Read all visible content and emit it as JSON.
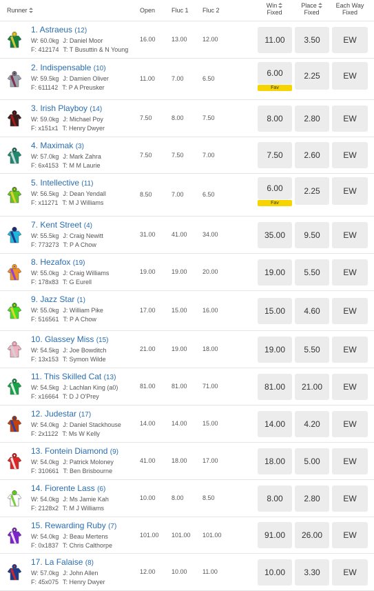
{
  "header": {
    "runner": "Runner",
    "open": "Open",
    "fluc1": "Fluc 1",
    "fluc2": "Fluc 2",
    "win": [
      "Win",
      "Fixed"
    ],
    "place": [
      "Place",
      "Fixed"
    ],
    "ew": [
      "Each Way",
      "Fixed"
    ]
  },
  "colors": {
    "link": "#2a6db0",
    "button": "#ececec",
    "fav": "#f6d400"
  },
  "runners": [
    {
      "name": "1. Astraeus",
      "barrier": "(12)",
      "weight": "W: 60.0kg",
      "jockey": "J: Daniel Moor",
      "form": "F: 412174",
      "trainer": "T: T Busuttin & N Young",
      "open": "16.00",
      "fluc1": "13.00",
      "fluc2": "12.00",
      "win": "11.00",
      "place": "3.50",
      "ew": "EW",
      "fav": "",
      "silk": [
        "#15803d",
        "#f5d33a",
        "#c8ad1b"
      ]
    },
    {
      "name": "2. Indispensable",
      "barrier": "(10)",
      "weight": "W: 59.5kg",
      "jockey": "J: Damien Oliver",
      "form": "F: 611142",
      "trainer": "T: P A Preusker",
      "open": "11.00",
      "fluc1": "7.00",
      "fluc2": "6.50",
      "win": "6.00",
      "place": "2.25",
      "ew": "EW",
      "fav": "Fav",
      "silk": [
        "#9ca3af",
        "#7a1f3d",
        "#6b7280"
      ]
    },
    {
      "name": "3. Irish Playboy",
      "barrier": "(14)",
      "weight": "W: 59.0kg",
      "jockey": "J: Michael Poy",
      "form": "F: x151x1",
      "trainer": "T: Henry Dwyer",
      "open": "7.50",
      "fluc1": "8.00",
      "fluc2": "7.50",
      "win": "8.00",
      "place": "2.80",
      "ew": "EW",
      "fav": "",
      "silk": [
        "#3b1d1d",
        "#b91c1c",
        "#2b1515"
      ]
    },
    {
      "name": "4. Maximak",
      "barrier": "(3)",
      "weight": "W: 57.0kg",
      "jockey": "J: Mark Zahra",
      "form": "F: 6x4153",
      "trainer": "T: M M Laurie",
      "open": "7.50",
      "fluc1": "7.50",
      "fluc2": "7.00",
      "win": "7.50",
      "place": "2.60",
      "ew": "EW",
      "fav": "",
      "silk": [
        "#1f8a70",
        "#e5e7eb",
        "#166651"
      ]
    },
    {
      "name": "5. Intellective",
      "barrier": "(11)",
      "weight": "W: 56.5kg",
      "jockey": "J: Dean Yendall",
      "form": "F: x11271",
      "trainer": "T: M J Williams",
      "open": "8.50",
      "fluc1": "7.00",
      "fluc2": "6.50",
      "win": "6.00",
      "place": "2.25",
      "ew": "EW",
      "fav": "Fav",
      "silk": [
        "#65c41e",
        "#f5d33a",
        "#4d9a15"
      ]
    },
    {
      "name": "7. Kent Street",
      "barrier": "(4)",
      "weight": "W: 55.5kg",
      "jockey": "J: Craig Newitt",
      "form": "F: 773273",
      "trainer": "T: P A Chow",
      "open": "31.00",
      "fluc1": "41.00",
      "fluc2": "34.00",
      "win": "35.00",
      "place": "9.50",
      "ew": "EW",
      "fav": "",
      "silk": [
        "#1fb6e0",
        "#1e2a78",
        "#1e2a78"
      ]
    },
    {
      "name": "8. Hezafox",
      "barrier": "(19)",
      "weight": "W: 55.0kg",
      "jockey": "J: Craig Williams",
      "form": "F: 178x83",
      "trainer": "T: G Eurell",
      "open": "19.00",
      "fluc1": "19.00",
      "fluc2": "20.00",
      "win": "19.00",
      "place": "5.50",
      "ew": "EW",
      "fav": "",
      "silk": [
        "#f28c28",
        "#7c3aed",
        "#f59e0b"
      ]
    },
    {
      "name": "9. Jazz Star",
      "barrier": "(1)",
      "weight": "W: 55.0kg",
      "jockey": "J: William Pike",
      "form": "F: 516561",
      "trainer": "T: P A Chow",
      "open": "17.00",
      "fluc1": "15.00",
      "fluc2": "16.00",
      "win": "15.00",
      "place": "4.60",
      "ew": "EW",
      "fav": "",
      "silk": [
        "#4ade1f",
        "#f5d33a",
        "#3aa316"
      ]
    },
    {
      "name": "10. Glassey Miss",
      "barrier": "(15)",
      "weight": "W: 54.5kg",
      "jockey": "J: Joe Bowditch",
      "form": "F: 13x153",
      "trainer": "T: Symon Wilde",
      "open": "21.00",
      "fluc1": "19.00",
      "fluc2": "18.00",
      "win": "19.00",
      "place": "5.50",
      "ew": "EW",
      "fav": "",
      "silk": [
        "#f0b3c0",
        "#d1d5db",
        "#e79aab"
      ]
    },
    {
      "name": "11. This Skilled Cat",
      "barrier": "(13)",
      "weight": "W: 54.5kg",
      "jockey": "J: Lachlan King (a0)",
      "form": "F: x16664",
      "trainer": "T: D J O'Prey",
      "open": "81.00",
      "fluc1": "81.00",
      "fluc2": "71.00",
      "win": "81.00",
      "place": "21.00",
      "ew": "EW",
      "fav": "",
      "silk": [
        "#16a34a",
        "#ffffff",
        "#15803d"
      ]
    },
    {
      "name": "12. Judestar",
      "barrier": "(17)",
      "weight": "W: 54.0kg",
      "jockey": "J: Daniel Stackhouse",
      "form": "F: 2x1122",
      "trainer": "T: Ms W Kelly",
      "open": "14.00",
      "fluc1": "14.00",
      "fluc2": "15.00",
      "win": "14.00",
      "place": "4.20",
      "ew": "EW",
      "fav": "",
      "silk": [
        "#c2410c",
        "#1e40af",
        "#9a3412"
      ]
    },
    {
      "name": "13. Fontein Diamond",
      "barrier": "(9)",
      "weight": "W: 54.0kg",
      "jockey": "J: Patrick Moloney",
      "form": "F: 310661",
      "trainer": "T: Ben Brisbourne",
      "open": "41.00",
      "fluc1": "18.00",
      "fluc2": "17.00",
      "win": "18.00",
      "place": "5.00",
      "ew": "EW",
      "fav": "",
      "silk": [
        "#dc2626",
        "#ffffff",
        "#b91c1c"
      ]
    },
    {
      "name": "14. Fiorente Lass",
      "barrier": "(6)",
      "weight": "W: 54.0kg",
      "jockey": "J: Ms Jamie Kah",
      "form": "F: 2128x2",
      "trainer": "T: M J Williams",
      "open": "10.00",
      "fluc1": "8.00",
      "fluc2": "8.50",
      "win": "8.00",
      "place": "2.80",
      "ew": "EW",
      "fav": "",
      "silk": [
        "#ffffff",
        "#65c41e",
        "#65c41e"
      ]
    },
    {
      "name": "15. Rewarding Ruby",
      "barrier": "(7)",
      "weight": "W: 54.0kg",
      "jockey": "J: Beau Mertens",
      "form": "F: 0x1837",
      "trainer": "T: Chris Calthorpe",
      "open": "101.00",
      "fluc1": "101.00",
      "fluc2": "101.00",
      "win": "91.00",
      "place": "26.00",
      "ew": "EW",
      "fav": "",
      "silk": [
        "#7e22ce",
        "#ffffff",
        "#6b21a8"
      ]
    },
    {
      "name": "17. La Falaise",
      "barrier": "(8)",
      "weight": "W: 57.0kg",
      "jockey": "J: John Allen",
      "form": "F: 45x075",
      "trainer": "T: Henry Dwyer",
      "open": "12.00",
      "fluc1": "10.00",
      "fluc2": "11.00",
      "win": "10.00",
      "place": "3.30",
      "ew": "EW",
      "fav": "",
      "silk": [
        "#1e3a8a",
        "#dc2626",
        "#1e3a8a"
      ]
    }
  ]
}
